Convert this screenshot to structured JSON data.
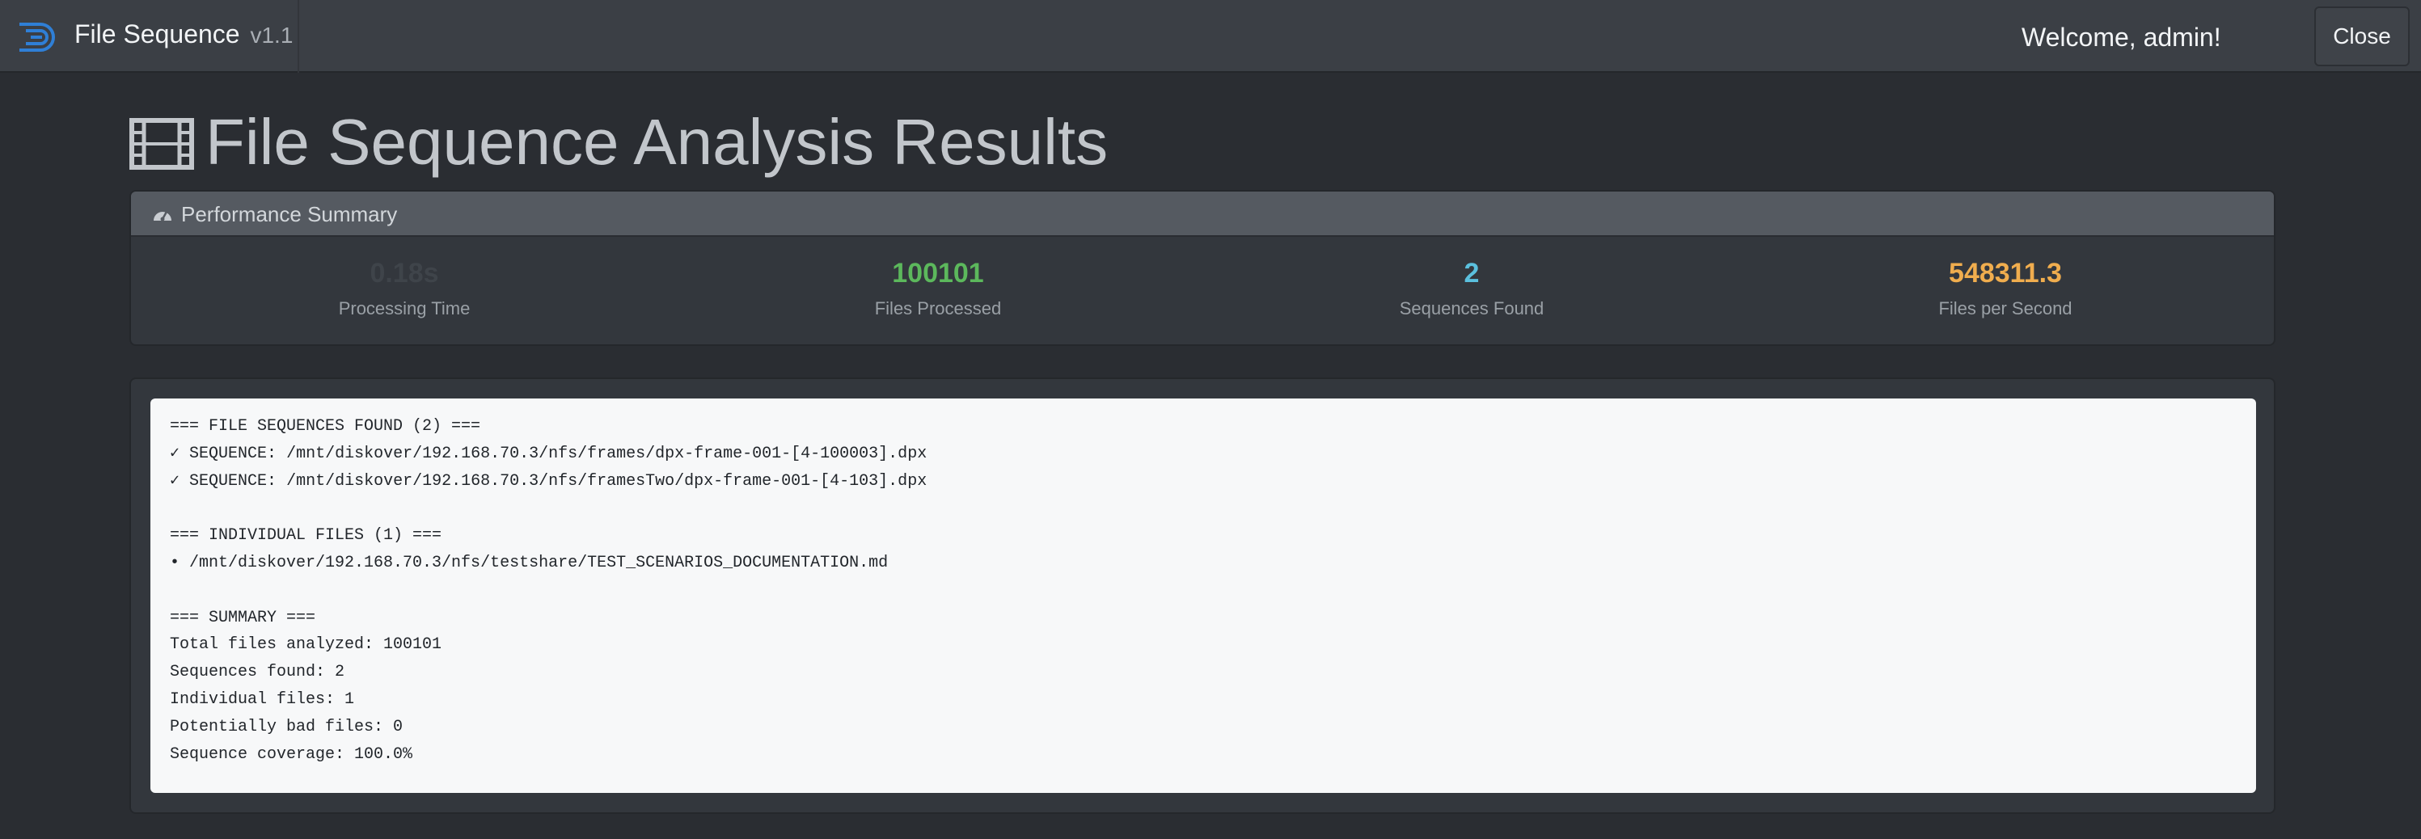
{
  "navbar": {
    "brand_name": "File Sequence",
    "brand_version": "v1.1",
    "welcome_text": "Welcome, admin!",
    "close_label": "Close"
  },
  "page": {
    "title": "File Sequence Analysis Results"
  },
  "performance": {
    "header": "Performance Summary",
    "stats": [
      {
        "value": "0.18s",
        "label": "Processing Time",
        "color": "#3f444a"
      },
      {
        "value": "100101",
        "label": "Files Processed",
        "color": "#5cb85c"
      },
      {
        "value": "2",
        "label": "Sequences Found",
        "color": "#5bc0de"
      },
      {
        "value": "548311.3",
        "label": "Files per Second",
        "color": "#f0ad4e"
      }
    ]
  },
  "results": {
    "lines": [
      "=== FILE SEQUENCES FOUND (2) ===",
      "✓ SEQUENCE: /mnt/diskover/192.168.70.3/nfs/frames/dpx-frame-001-[4-100003].dpx",
      "✓ SEQUENCE: /mnt/diskover/192.168.70.3/nfs/framesTwo/dpx-frame-001-[4-103].dpx",
      "",
      "=== INDIVIDUAL FILES (1) ===",
      "• /mnt/diskover/192.168.70.3/nfs/testshare/TEST_SCENARIOS_DOCUMENTATION.md",
      "",
      "=== SUMMARY ===",
      "Total files analyzed: 100101",
      "Sequences found: 2",
      "Individual files: 1",
      "Potentially bad files: 0",
      "Sequence coverage: 100.0%"
    ]
  },
  "colors": {
    "accent_blue": "#2f7fd6",
    "success": "#5cb85c",
    "info": "#5bc0de",
    "warning": "#f0ad4e"
  },
  "icons": {
    "brand": "logo-icon",
    "title": "film-icon",
    "performance": "gauge-icon"
  }
}
